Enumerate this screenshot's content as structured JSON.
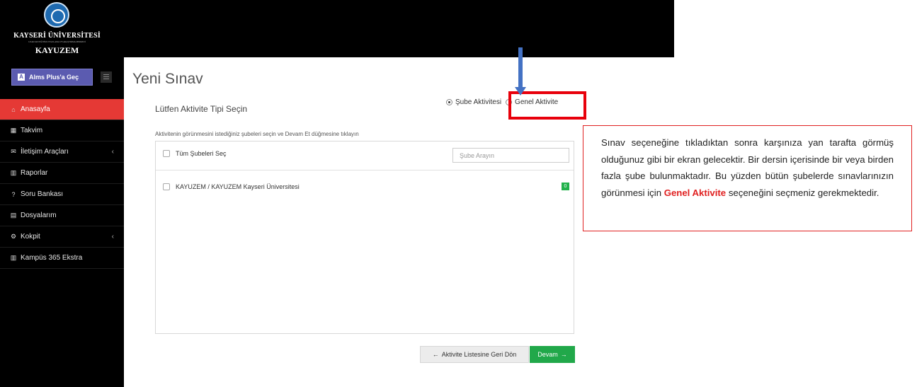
{
  "brand": {
    "name": "KAYSERİ ÜNİVERSİTESİ",
    "subtitle": "UZAKTAN EĞİTİM UYGULAMA VE ARAŞTIRMA MERKEZİ",
    "short": "KAYUZEM"
  },
  "sidebar": {
    "alms_button": "Alms Plus'a Geç",
    "items": [
      {
        "label": "Anasayfa",
        "icon": "home-icon",
        "glyph": "⌂",
        "active": true,
        "has_chevron": false
      },
      {
        "label": "Takvim",
        "icon": "calendar-icon",
        "glyph": "▦",
        "active": false,
        "has_chevron": false
      },
      {
        "label": "İletişim Araçları",
        "icon": "envelope-icon",
        "glyph": "✉",
        "active": false,
        "has_chevron": true
      },
      {
        "label": "Raporlar",
        "icon": "bar-chart-icon",
        "glyph": "▥",
        "active": false,
        "has_chevron": false
      },
      {
        "label": "Soru Bankası",
        "icon": "question-icon",
        "glyph": "?",
        "active": false,
        "has_chevron": false
      },
      {
        "label": "Dosyalarım",
        "icon": "file-icon",
        "glyph": "▤",
        "active": false,
        "has_chevron": false
      },
      {
        "label": "Kokpit",
        "icon": "cogs-icon",
        "glyph": "⚙",
        "active": false,
        "has_chevron": true
      },
      {
        "label": "Kampüs 365 Ekstra",
        "icon": "bar-chart-icon",
        "glyph": "▥",
        "active": false,
        "has_chevron": false
      }
    ],
    "chevron": "‹"
  },
  "main": {
    "title": "Yeni Sınav",
    "activity_type_label": "Lütfen Aktivite Tipi Seçin",
    "radio_branch": "Şube Aktivitesi",
    "radio_general": "Genel Aktivite",
    "instruction": "Aktivitenin görünmesini istediğiniz şubeleri seçin ve Devam Et düğmesine tıklayın",
    "select_all": "Tüm Şubeleri Seç",
    "search_placeholder": "Şube Arayın",
    "branches": [
      {
        "name": "KAYUZEM / KAYUZEM Kayseri Üniversitesi",
        "count": "0"
      }
    ],
    "back_button": "Aktivite Listesine Geri Dön",
    "next_button": "Devam"
  },
  "annotation": {
    "text_before": "Sınav seçeneğine tıkladıktan sonra karşınıza yan tarafta görmüş olduğunuz gibi bir ekran gelecektir. Bir dersin içerisinde bir veya birden fazla şube bulunmaktadır. Bu yüzden bütün şubelerde sınavlarınızın görünmesi için ",
    "highlight": "Genel Aktivite",
    "text_after": " seçeneğini seçmeniz gerekmektedir."
  },
  "colors": {
    "active_menu": "#e53935",
    "alms_button": "#5b5bb0",
    "next_button": "#21a84a",
    "annotation_red": "#e02020",
    "arrow_blue": "#4472c4"
  }
}
